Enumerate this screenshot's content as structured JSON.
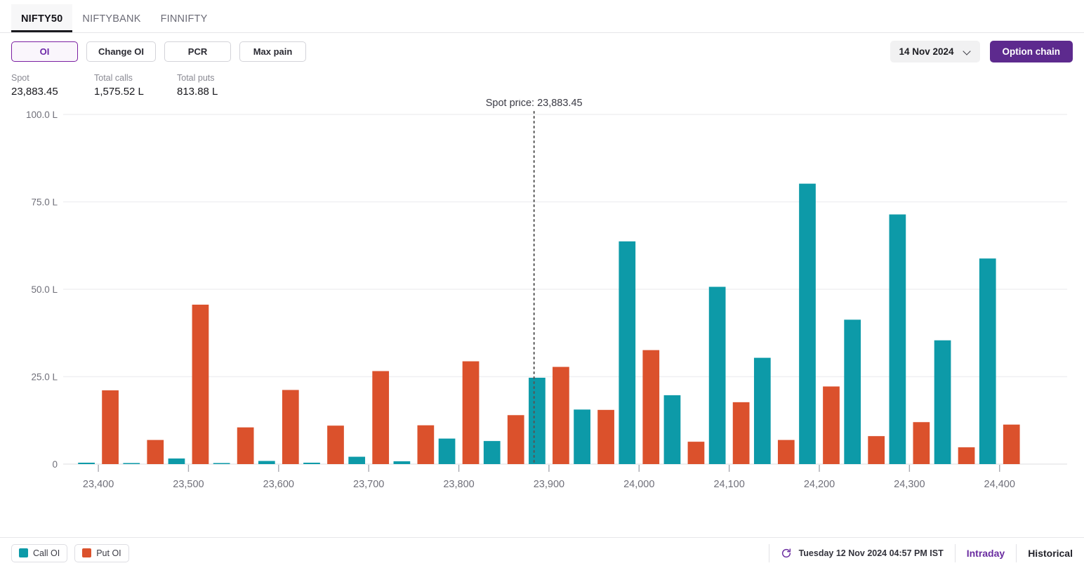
{
  "tabs": [
    {
      "label": "NIFTY50",
      "active": true
    },
    {
      "label": "NIFTYBANK",
      "active": false
    },
    {
      "label": "FINNIFTY",
      "active": false
    }
  ],
  "toolbar": {
    "metrics": [
      {
        "label": "OI",
        "active": true
      },
      {
        "label": "Change OI",
        "active": false
      },
      {
        "label": "PCR",
        "active": false
      },
      {
        "label": "Max pain",
        "active": false
      }
    ],
    "expiry_date": "14 Nov 2024",
    "expiry_chevron_icon": "chevron-down-icon",
    "option_chain_label": "Option chain"
  },
  "stats": [
    {
      "label": "Spot",
      "value": "23,883.45"
    },
    {
      "label": "Total calls",
      "value": "1,575.52 L"
    },
    {
      "label": "Total puts",
      "value": "813.88 L"
    }
  ],
  "footer": {
    "legend": [
      {
        "label": "Call OI",
        "color": "#0d9aa8"
      },
      {
        "label": "Put OI",
        "color": "#db512c"
      }
    ],
    "refresh_icon": "refresh-icon",
    "timestamp": "Tuesday 12 Nov 2024 04:57 PM IST",
    "links": [
      {
        "label": "Intraday",
        "active": true
      },
      {
        "label": "Historical",
        "active": false
      }
    ]
  },
  "chart_data": {
    "type": "bar",
    "title": "",
    "xlabel": "",
    "ylabel": "",
    "ylim": [
      0,
      100
    ],
    "yticks": [
      0,
      25,
      50,
      75,
      100
    ],
    "ytick_labels": [
      "0",
      "25.0 L",
      "50.0 L",
      "75.0 L",
      "100.0 L"
    ],
    "grid": true,
    "legend_position": "bottom-left",
    "unit": "L",
    "annotation": {
      "label": "Spot price: 23,883.45",
      "x_value": 23883.45,
      "style": "dotted-vertical-line",
      "color": "#555555"
    },
    "categories": [
      23400,
      23450,
      23500,
      23550,
      23600,
      23650,
      23700,
      23750,
      23800,
      23850,
      23900,
      23950,
      24000,
      24050,
      24100,
      24150,
      24200,
      24250,
      24300,
      24350,
      24400,
      24450
    ],
    "xtick_labels": [
      "23,400",
      "23,500",
      "23,600",
      "23,700",
      "23,800",
      "23,900",
      "24,000",
      "24,100",
      "24,200",
      "24,300",
      "24,400"
    ],
    "series": [
      {
        "name": "Call OI",
        "color": "#0d9aa8",
        "values": [
          0.4,
          0.3,
          1.6,
          0.3,
          0.9,
          0.4,
          2.1,
          0.8,
          7.3,
          6.6,
          24.7,
          15.6,
          63.7,
          19.7,
          50.7,
          30.4,
          80.2,
          41.3,
          71.4,
          35.4,
          58.8,
          0
        ]
      },
      {
        "name": "Put OI",
        "color": "#db512c",
        "values": [
          21.1,
          6.9,
          45.6,
          10.5,
          21.2,
          11.0,
          26.6,
          11.1,
          29.4,
          14.0,
          27.8,
          15.5,
          32.6,
          6.4,
          17.7,
          6.9,
          22.2,
          8.0,
          12.0,
          4.8,
          11.3,
          0
        ]
      }
    ]
  }
}
